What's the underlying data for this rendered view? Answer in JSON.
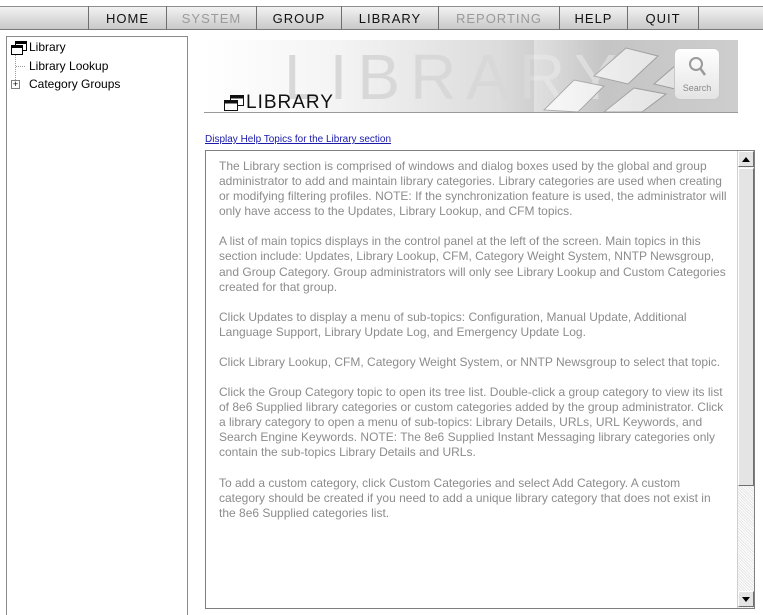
{
  "nav": {
    "items": [
      {
        "label": "HOME",
        "enabled": true
      },
      {
        "label": "SYSTEM",
        "enabled": false
      },
      {
        "label": "GROUP",
        "enabled": true
      },
      {
        "label": "LIBRARY",
        "enabled": true
      },
      {
        "label": "REPORTING",
        "enabled": false
      },
      {
        "label": "HELP",
        "enabled": true
      },
      {
        "label": "QUIT",
        "enabled": true
      }
    ]
  },
  "tree": {
    "root": {
      "label": "Library",
      "icon": "window-icon"
    },
    "children": [
      {
        "label": "Library Lookup",
        "expandable": false
      },
      {
        "label": "Category Groups",
        "expandable": true,
        "expander": "+"
      }
    ]
  },
  "banner": {
    "title": "LIBRARY",
    "watermark": "LIBRARY",
    "search_label": "Search"
  },
  "help_link": "Display Help Topics for the Library section",
  "content": {
    "paragraphs": [
      "The Library section is comprised of windows and dialog boxes used by the global and group administrator to add and maintain library categories. Library categories are used when creating or modifying filtering profiles. NOTE: If the synchronization feature is used, the administrator will only have access to the Updates, Library Lookup, and CFM topics.",
      "A list of main topics displays in the control panel at the left of the screen. Main topics in this section include: Updates, Library Lookup, CFM, Category Weight System, NNTP Newsgroup, and Group Category. Group administrators will only see Library Lookup and Custom Categories created for that group.",
      "Click Updates to display a menu of sub-topics: Configuration, Manual Update, Additional Language Support, Library Update Log, and Emergency Update Log.",
      "Click Library Lookup, CFM, Category Weight System, or NNTP Newsgroup to select that topic.",
      "Click the Group Category topic to open its tree list. Double-click a group category to view its list of 8e6 Supplied library categories or custom categories added by the group administrator. Click a library category to open a menu of sub-topics: Library Details, URLs, URL Keywords, and Search Engine Keywords. NOTE: The 8e6 Supplied Instant Messaging library categories only contain the sub-topics Library Details and URLs.",
      "To add a custom category, click Custom Categories and select Add Category. A custom category should be created if you need to add a unique library category that does not exist in the 8e6 Supplied categories list."
    ]
  }
}
